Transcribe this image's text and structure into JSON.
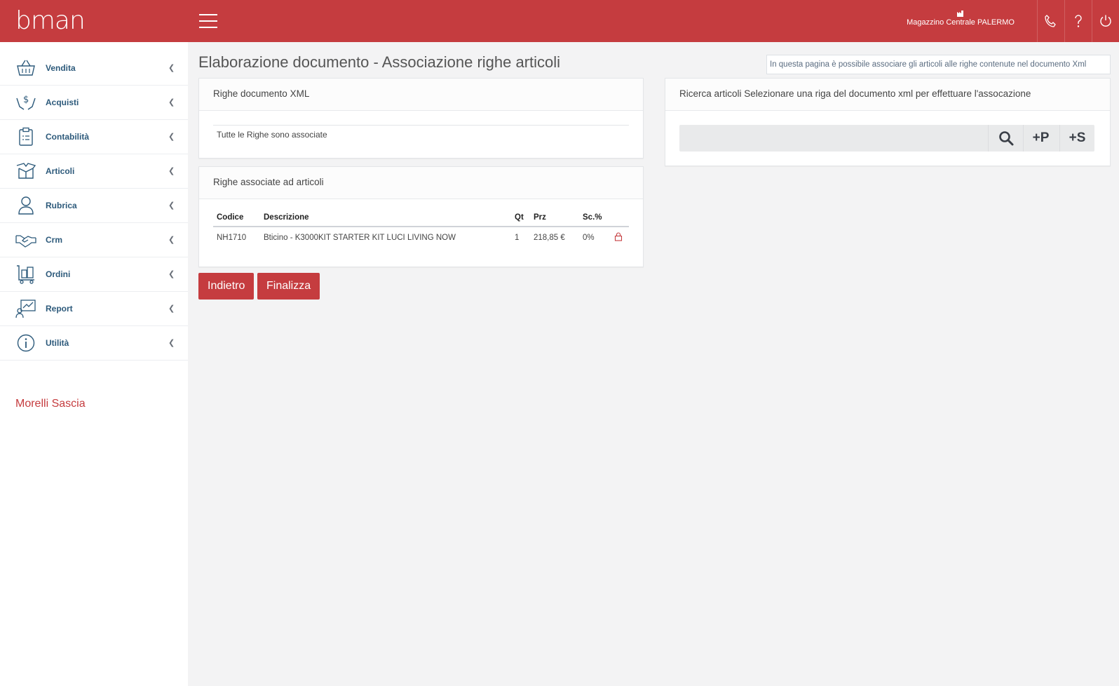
{
  "header": {
    "logo": "bman",
    "warehouse": "Magazzino Centrale PALERMO",
    "icons": [
      "phone-icon",
      "help-icon",
      "power-icon"
    ],
    "brand_color": "#c53c3f"
  },
  "sidebar": {
    "items": [
      {
        "label": "Vendita",
        "icon": "basket-icon"
      },
      {
        "label": "Acquisti",
        "icon": "hands-money-icon"
      },
      {
        "label": "Contabilità",
        "icon": "clipboard-icon"
      },
      {
        "label": "Articoli",
        "icon": "box-icon"
      },
      {
        "label": "Rubrica",
        "icon": "person-icon"
      },
      {
        "label": "Crm",
        "icon": "handshake-icon"
      },
      {
        "label": "Ordini",
        "icon": "cart-boxes-icon"
      },
      {
        "label": "Report",
        "icon": "chart-report-icon"
      },
      {
        "label": "Utilità",
        "icon": "info-icon"
      }
    ],
    "user": "Morelli Sascia"
  },
  "main": {
    "title": "Elaborazione documento - Associazione righe articoli",
    "info": "In questa pagina è possibile associare gli articoli alle righe contenute nel documento Xml",
    "xml_panel": {
      "title": "Righe documento XML",
      "message": "Tutte le Righe sono associate"
    },
    "assoc_panel": {
      "title": "Righe associate ad articoli",
      "columns": [
        "Codice",
        "Descrizione",
        "Qt",
        "Prz",
        "Sc.%"
      ],
      "rows": [
        {
          "codice": "NH1710",
          "descrizione": "Bticino - K3000KIT STARTER KIT LUCI LIVING NOW",
          "qt": "1",
          "prz": "218,85 €",
          "sc": "0%",
          "icon": "lock-icon"
        }
      ]
    },
    "search_panel": {
      "title": "Ricerca articoli Selezionare una riga del documento xml per effettuare l'assocazione",
      "input_value": "",
      "btn_p": "+P",
      "btn_s": "+S"
    },
    "buttons": {
      "back": "Indietro",
      "finalize": "Finalizza"
    }
  }
}
